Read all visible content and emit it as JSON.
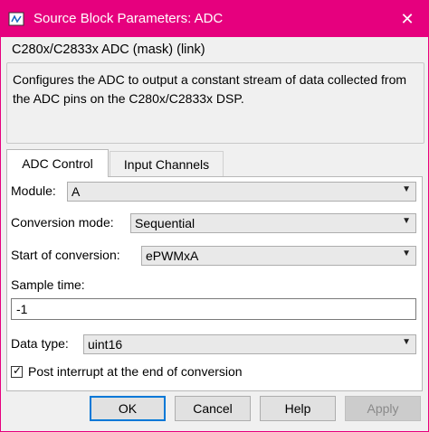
{
  "window": {
    "title": "Source Block Parameters: ADC",
    "title_bar_color": "#e6007e",
    "close_glyph": "✕"
  },
  "block": {
    "header": "C280x/C2833x ADC (mask) (link)",
    "description": "Configures the ADC to output a constant stream of data collected from the ADC pins on the C280x/C2833x DSP."
  },
  "tabs": [
    {
      "label": "ADC Control",
      "active": true
    },
    {
      "label": "Input Channels",
      "active": false
    }
  ],
  "params": {
    "module": {
      "label": "Module:",
      "value": "A"
    },
    "conversion_mode": {
      "label": "Conversion mode:",
      "value": "Sequential"
    },
    "start_of_conversion": {
      "label": "Start of conversion:",
      "value": "ePWMxA"
    },
    "sample_time": {
      "label": "Sample time:",
      "value": "-1"
    },
    "data_type": {
      "label": "Data type:",
      "value": "uint16"
    },
    "post_interrupt": {
      "label": "Post interrupt at the end of conversion",
      "checked": true,
      "check_glyph": "✓"
    }
  },
  "dropdown_arrow": "▼",
  "buttons": {
    "ok": "OK",
    "cancel": "Cancel",
    "help": "Help",
    "apply": "Apply"
  }
}
